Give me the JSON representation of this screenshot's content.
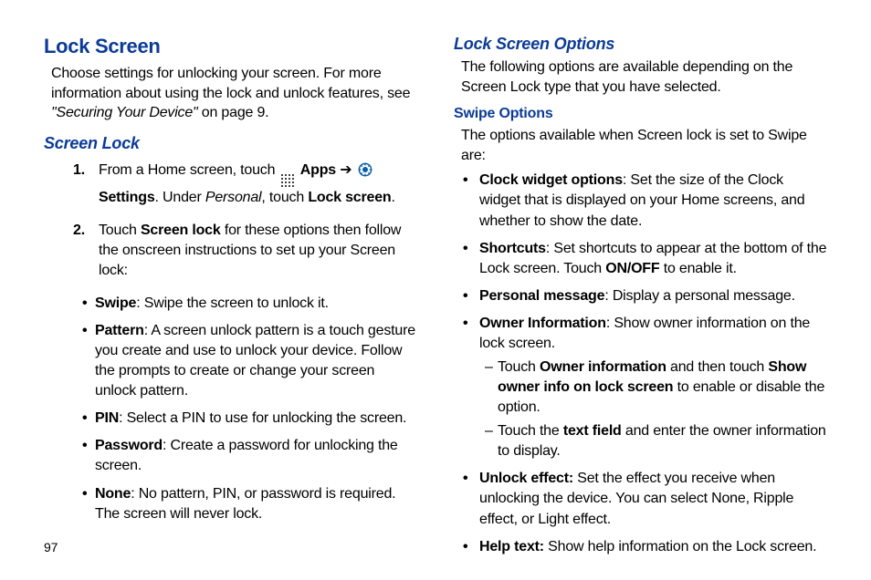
{
  "pageNumber": "97",
  "left": {
    "h1": "Lock Screen",
    "intro_1": "Choose settings for unlocking your screen. For more information about using the lock and unlock features, see ",
    "intro_ref": "\"Securing Your Device\"",
    "intro_2": " on page 9.",
    "h2_screenlock": "Screen Lock",
    "step1_pre": "From a Home screen, touch ",
    "step1_apps": "Apps",
    "arrow": " ➔ ",
    "step1_settings": "Settings",
    "step1_post1": ". Under ",
    "step1_personal": "Personal",
    "step1_post2": ", touch ",
    "step1_lockscreen": "Lock screen",
    "step1_end": ".",
    "step2_pre": "Touch ",
    "step2_screenlock": "Screen lock",
    "step2_post": " for these options then follow the onscreen instructions to set up your Screen lock:",
    "opt_swipe_b": "Swipe",
    "opt_swipe": ": Swipe the screen to unlock it.",
    "opt_pattern_b": "Pattern",
    "opt_pattern": ": A screen unlock pattern is a touch gesture you create and use to unlock your device. Follow the prompts to create or change your screen unlock pattern.",
    "opt_pin_b": "PIN",
    "opt_pin": ": Select a PIN to use for unlocking the screen.",
    "opt_password_b": "Password",
    "opt_password": ": Create a password for unlocking the screen.",
    "opt_none_b": "None",
    "opt_none": ": No pattern, PIN, or password is required. The screen will never lock."
  },
  "right": {
    "h2_options": "Lock Screen Options",
    "options_intro": "The following options are available depending on the Screen Lock type that you have selected.",
    "h3_swipe": "Swipe Options",
    "swipe_intro": "The options available when Screen lock is set to Swipe are:",
    "b_clock_b": "Clock widget options",
    "b_clock": ": Set the size of the Clock widget that is displayed on your Home screens, and whether to show the date.",
    "b_shortcuts_b": "Shortcuts",
    "b_shortcuts_1": ": Set shortcuts to appear at the bottom of the Lock screen. Touch ",
    "b_shortcuts_onoff": "ON/OFF",
    "b_shortcuts_2": " to enable it.",
    "b_pmsg_b": "Personal message",
    "b_pmsg": ": Display a personal message.",
    "b_owner_b": "Owner Information",
    "b_owner": ": Show owner information on the lock screen.",
    "b_owner_s1_pre": "Touch ",
    "b_owner_s1_b1": "Owner information",
    "b_owner_s1_mid": " and then touch ",
    "b_owner_s1_b2": "Show owner info on lock screen",
    "b_owner_s1_end": " to enable or disable the option.",
    "b_owner_s2_pre": "Touch the ",
    "b_owner_s2_b": "text field",
    "b_owner_s2_end": " and enter the owner information to display.",
    "b_unlock_b": "Unlock effect:",
    "b_unlock": " Set the effect you receive when unlocking the device. You can select None, Ripple effect, or Light effect.",
    "b_help_b": "Help text:",
    "b_help": " Show help information on the Lock screen."
  }
}
